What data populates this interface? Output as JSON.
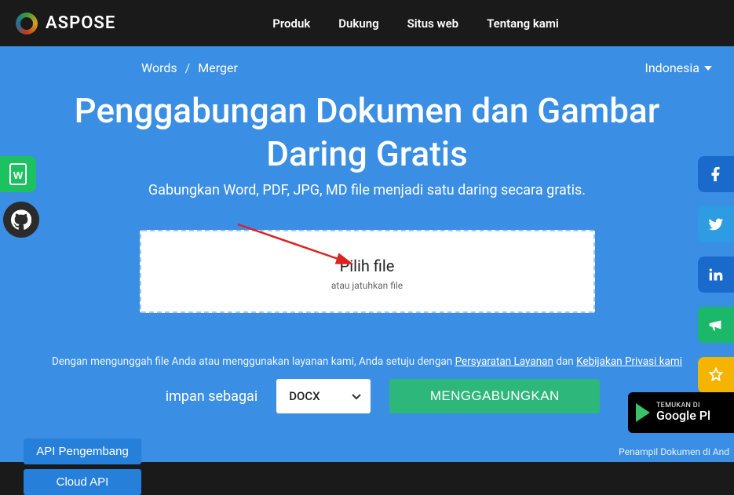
{
  "brand": "ASPOSE",
  "nav": {
    "product": "Produk",
    "support": "Dukung",
    "site": "Situs web",
    "about": "Tentang kami"
  },
  "breadcrumb": {
    "words": "Words",
    "merger": "Merger"
  },
  "language": "Indonesia",
  "title": "Penggabungan Dokumen dan Gambar Daring Gratis",
  "subtitle": "Gabungkan Word, PDF, JPG, MD file menjadi satu daring secara gratis.",
  "dropzone": {
    "pick": "Pilih file",
    "drop": "atau jatuhkan file"
  },
  "terms": {
    "prefix": "Dengan mengunggah file Anda atau menggunakan layanan kami, Anda setuju dengan ",
    "tos": "Persyaratan Layanan",
    "and": " dan ",
    "privacy": "Kebijakan Privasi kami"
  },
  "save_as_label": "impan sebagai",
  "format_selected": "DOCX",
  "merge_label": "MENGGABUNGKAN",
  "gplay": {
    "small": "TEMUKAN DI",
    "big": "Google Pl"
  },
  "viewer_note": "Penampil Dokumen di And",
  "api": {
    "dev": "API Pengembang",
    "cloud": "Cloud API"
  }
}
